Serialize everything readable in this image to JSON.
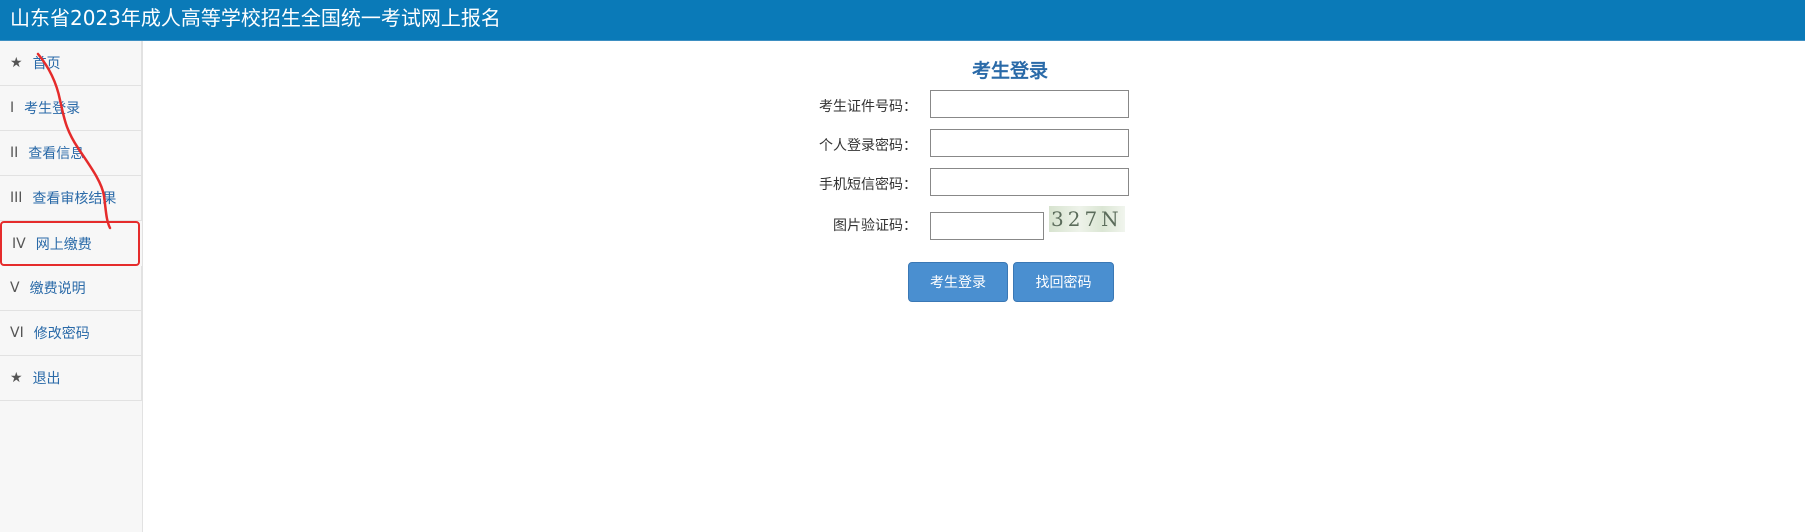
{
  "header": {
    "title": "山东省2023年成人高等学校招生全国统一考试网上报名"
  },
  "sidebar": {
    "items": [
      {
        "mark": "★",
        "label": "首页"
      },
      {
        "mark": "I",
        "label": "考生登录"
      },
      {
        "mark": "II",
        "label": "查看信息"
      },
      {
        "mark": "III",
        "label": "查看审核结果"
      },
      {
        "mark": "IV",
        "label": "网上缴费"
      },
      {
        "mark": "V",
        "label": "缴费说明"
      },
      {
        "mark": "VI",
        "label": "修改密码"
      },
      {
        "mark": "★",
        "label": "退出"
      }
    ]
  },
  "form": {
    "title": "考生登录",
    "id_label": "考生证件号码：",
    "password_label": "个人登录密码：",
    "sms_label": "手机短信密码：",
    "captcha_label": "图片验证码：",
    "captcha_text": "327N",
    "id_value": "",
    "password_value": "",
    "sms_value": "",
    "captcha_value": "",
    "login_button": "考生登录",
    "recover_button": "找回密码"
  },
  "colors": {
    "header_bg": "#0a7ab8",
    "link": "#2a6aa8",
    "button": "#4a8fd0",
    "annotation": "#e52b2b"
  }
}
